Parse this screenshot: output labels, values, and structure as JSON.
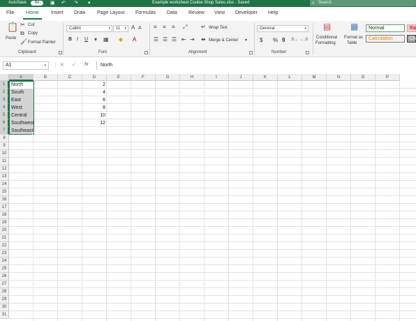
{
  "titlebar": {
    "autosave_label": "AutoSave",
    "autosave_state": "On",
    "document_title": "Example worksheet Cookie Shop Sales.xlsx - Saved",
    "search_placeholder": "Search"
  },
  "menu": {
    "tabs": [
      "File",
      "Home",
      "Insert",
      "Draw",
      "Page Layout",
      "Formulas",
      "Data",
      "Review",
      "View",
      "Developer",
      "Help"
    ],
    "active": "Home"
  },
  "ribbon": {
    "clipboard": {
      "paste": "Paste",
      "cut": "Cut",
      "copy": "Copy",
      "format_painter": "Format Painter",
      "label": "Clipboard"
    },
    "font": {
      "font_name": "Calibri",
      "font_size": "11",
      "bold": "B",
      "italic": "I",
      "underline": "U",
      "label": "Font"
    },
    "alignment": {
      "wrap_text": "Wrap Text",
      "merge_center": "Merge & Center",
      "label": "Alignment"
    },
    "number": {
      "format": "General",
      "currency": "$",
      "percent": "%",
      "comma": "9",
      "label": "Number"
    },
    "styles": {
      "conditional_formatting": [
        "Conditional",
        "Formatting"
      ],
      "format_as_table": [
        "Format as",
        "Table"
      ],
      "normal": "Normal",
      "bad": "Bad",
      "calculation": "Calculation",
      "check": "Che"
    }
  },
  "formula_bar": {
    "name_box": "A1",
    "cancel": "✕",
    "enter": "✓",
    "fx": "fx",
    "content": "North"
  },
  "grid": {
    "columns": [
      "A",
      "B",
      "C",
      "D",
      "E",
      "F",
      "G",
      "H",
      "I",
      "J",
      "K",
      "L",
      "M",
      "N",
      "O",
      "P"
    ],
    "rows": [
      "1",
      "2",
      "3",
      "4",
      "5",
      "6",
      "7",
      "8",
      "9",
      "10",
      "11",
      "12",
      "13",
      "14",
      "15",
      "16",
      "17",
      "18",
      "19",
      "20",
      "21",
      "22",
      "23",
      "24",
      "25",
      "26",
      "27",
      "28",
      "29",
      "30",
      "31"
    ],
    "column_a": [
      "North",
      "South",
      "East",
      "West",
      "Central",
      "Southwest",
      "Southeast"
    ],
    "column_d": [
      "2",
      "4",
      "6",
      "8",
      "10",
      "12"
    ]
  },
  "colors": {
    "accent": "#217346",
    "selection": "#d3d3d3"
  }
}
